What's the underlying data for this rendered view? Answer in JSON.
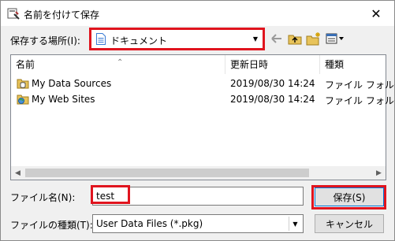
{
  "window": {
    "title": "名前を付けて保存",
    "close_glyph": "✕"
  },
  "location": {
    "label": "保存する場所(I):",
    "value": "ドキュメント"
  },
  "toolbar": {
    "back_icon": "back-arrow-icon",
    "up_icon": "up-folder-icon",
    "new_folder_icon": "new-folder-icon",
    "view_menu_icon": "view-menu-icon"
  },
  "file_list": {
    "columns": [
      "名前",
      "更新日時",
      "種類"
    ],
    "rows": [
      {
        "name": "My Data Sources",
        "date": "2019/08/30 14:24",
        "type": "ファイル フォルダー"
      },
      {
        "name": "My Web Sites",
        "date": "2019/08/30 14:24",
        "type": "ファイル フォルダー"
      }
    ]
  },
  "filename": {
    "label": "ファイル名(N):",
    "value": "test"
  },
  "filetype": {
    "label": "ファイルの種類(T):",
    "value": "User Data Files (*.pkg)"
  },
  "buttons": {
    "save": "保存(S)",
    "cancel": "キャンセル"
  },
  "colors": {
    "highlight": "#e0141e",
    "default_border": "#0078d7"
  }
}
